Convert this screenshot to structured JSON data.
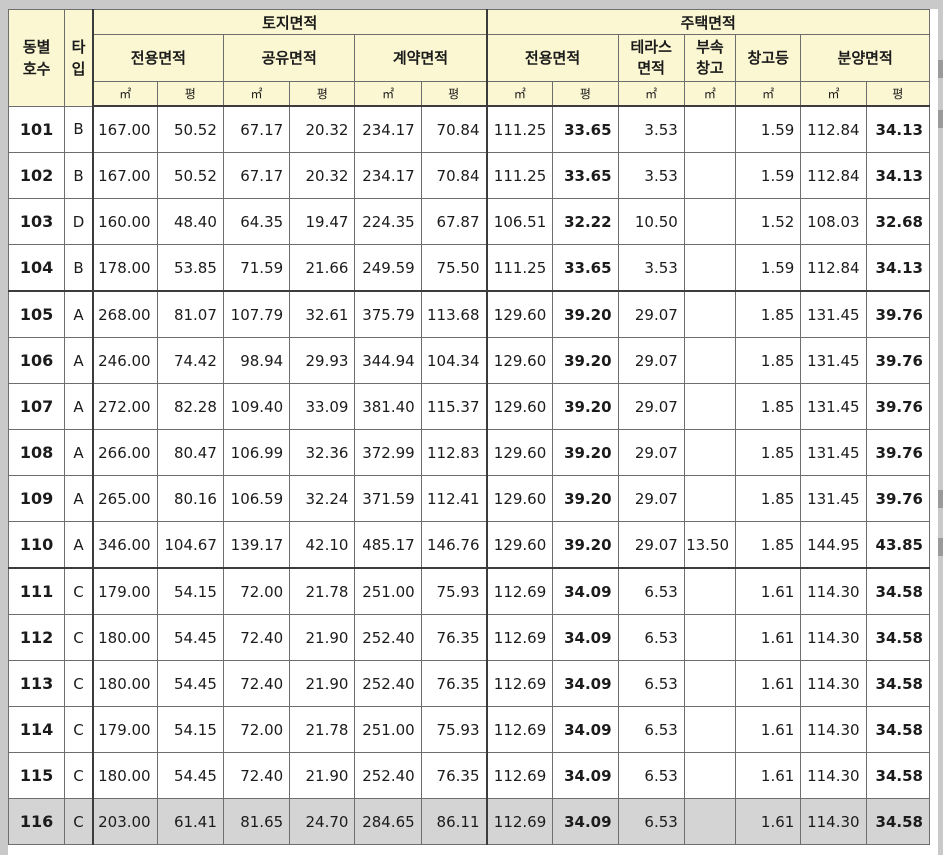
{
  "header": {
    "col_dong": "동별\n호수",
    "col_type": "타\n입",
    "land_area": "토지면적",
    "house_area": "주택면적",
    "land_sub": [
      "전용면적",
      "공유면적",
      "계약면적"
    ],
    "house_sub": [
      "전용면적",
      "테라스\n면적",
      "부속\n창고",
      "창고등",
      "분양면적"
    ],
    "unit_m2": "㎡",
    "unit_py": "평"
  },
  "rows": [
    {
      "no": "101",
      "type": "B",
      "l1": "167.00",
      "p1": "50.52",
      "l2": "67.17",
      "p2": "20.32",
      "l3": "234.17",
      "p3": "70.84",
      "h1": "111.25",
      "hp1": "33.65",
      "ter": "3.53",
      "annex": "",
      "store": "1.59",
      "sale": "112.84",
      "salep": "34.13"
    },
    {
      "no": "102",
      "type": "B",
      "l1": "167.00",
      "p1": "50.52",
      "l2": "67.17",
      "p2": "20.32",
      "l3": "234.17",
      "p3": "70.84",
      "h1": "111.25",
      "hp1": "33.65",
      "ter": "3.53",
      "annex": "",
      "store": "1.59",
      "sale": "112.84",
      "salep": "34.13"
    },
    {
      "no": "103",
      "type": "D",
      "l1": "160.00",
      "p1": "48.40",
      "l2": "64.35",
      "p2": "19.47",
      "l3": "224.35",
      "p3": "67.87",
      "h1": "106.51",
      "hp1": "32.22",
      "ter": "10.50",
      "annex": "",
      "store": "1.52",
      "sale": "108.03",
      "salep": "32.68"
    },
    {
      "no": "104",
      "type": "B",
      "l1": "178.00",
      "p1": "53.85",
      "l2": "71.59",
      "p2": "21.66",
      "l3": "249.59",
      "p3": "75.50",
      "h1": "111.25",
      "hp1": "33.65",
      "ter": "3.53",
      "annex": "",
      "store": "1.59",
      "sale": "112.84",
      "salep": "34.13"
    },
    {
      "no": "105",
      "type": "A",
      "l1": "268.00",
      "p1": "81.07",
      "l2": "107.79",
      "p2": "32.61",
      "l3": "375.79",
      "p3": "113.68",
      "h1": "129.60",
      "hp1": "39.20",
      "ter": "29.07",
      "annex": "",
      "store": "1.85",
      "sale": "131.45",
      "salep": "39.76"
    },
    {
      "no": "106",
      "type": "A",
      "l1": "246.00",
      "p1": "74.42",
      "l2": "98.94",
      "p2": "29.93",
      "l3": "344.94",
      "p3": "104.34",
      "h1": "129.60",
      "hp1": "39.20",
      "ter": "29.07",
      "annex": "",
      "store": "1.85",
      "sale": "131.45",
      "salep": "39.76"
    },
    {
      "no": "107",
      "type": "A",
      "l1": "272.00",
      "p1": "82.28",
      "l2": "109.40",
      "p2": "33.09",
      "l3": "381.40",
      "p3": "115.37",
      "h1": "129.60",
      "hp1": "39.20",
      "ter": "29.07",
      "annex": "",
      "store": "1.85",
      "sale": "131.45",
      "salep": "39.76"
    },
    {
      "no": "108",
      "type": "A",
      "l1": "266.00",
      "p1": "80.47",
      "l2": "106.99",
      "p2": "32.36",
      "l3": "372.99",
      "p3": "112.83",
      "h1": "129.60",
      "hp1": "39.20",
      "ter": "29.07",
      "annex": "",
      "store": "1.85",
      "sale": "131.45",
      "salep": "39.76"
    },
    {
      "no": "109",
      "type": "A",
      "l1": "265.00",
      "p1": "80.16",
      "l2": "106.59",
      "p2": "32.24",
      "l3": "371.59",
      "p3": "112.41",
      "h1": "129.60",
      "hp1": "39.20",
      "ter": "29.07",
      "annex": "",
      "store": "1.85",
      "sale": "131.45",
      "salep": "39.76"
    },
    {
      "no": "110",
      "type": "A",
      "l1": "346.00",
      "p1": "104.67",
      "l2": "139.17",
      "p2": "42.10",
      "l3": "485.17",
      "p3": "146.76",
      "h1": "129.60",
      "hp1": "39.20",
      "ter": "29.07",
      "annex": "13.50",
      "store": "1.85",
      "sale": "144.95",
      "salep": "43.85"
    },
    {
      "no": "111",
      "type": "C",
      "l1": "179.00",
      "p1": "54.15",
      "l2": "72.00",
      "p2": "21.78",
      "l3": "251.00",
      "p3": "75.93",
      "h1": "112.69",
      "hp1": "34.09",
      "ter": "6.53",
      "annex": "",
      "store": "1.61",
      "sale": "114.30",
      "salep": "34.58"
    },
    {
      "no": "112",
      "type": "C",
      "l1": "180.00",
      "p1": "54.45",
      "l2": "72.40",
      "p2": "21.90",
      "l3": "252.40",
      "p3": "76.35",
      "h1": "112.69",
      "hp1": "34.09",
      "ter": "6.53",
      "annex": "",
      "store": "1.61",
      "sale": "114.30",
      "salep": "34.58"
    },
    {
      "no": "113",
      "type": "C",
      "l1": "180.00",
      "p1": "54.45",
      "l2": "72.40",
      "p2": "21.90",
      "l3": "252.40",
      "p3": "76.35",
      "h1": "112.69",
      "hp1": "34.09",
      "ter": "6.53",
      "annex": "",
      "store": "1.61",
      "sale": "114.30",
      "salep": "34.58"
    },
    {
      "no": "114",
      "type": "C",
      "l1": "179.00",
      "p1": "54.15",
      "l2": "72.00",
      "p2": "21.78",
      "l3": "251.00",
      "p3": "75.93",
      "h1": "112.69",
      "hp1": "34.09",
      "ter": "6.53",
      "annex": "",
      "store": "1.61",
      "sale": "114.30",
      "salep": "34.58"
    },
    {
      "no": "115",
      "type": "C",
      "l1": "180.00",
      "p1": "54.45",
      "l2": "72.40",
      "p2": "21.90",
      "l3": "252.40",
      "p3": "76.35",
      "h1": "112.69",
      "hp1": "34.09",
      "ter": "6.53",
      "annex": "",
      "store": "1.61",
      "sale": "114.30",
      "salep": "34.58"
    },
    {
      "no": "116",
      "type": "C",
      "l1": "203.00",
      "p1": "61.41",
      "l2": "81.65",
      "p2": "24.70",
      "l3": "284.65",
      "p3": "86.11",
      "h1": "112.69",
      "hp1": "34.09",
      "ter": "6.53",
      "annex": "",
      "store": "1.61",
      "sale": "114.30",
      "salep": "34.58"
    }
  ],
  "group_breaks_after": [
    "104",
    "110"
  ],
  "highlighted_row": "116"
}
